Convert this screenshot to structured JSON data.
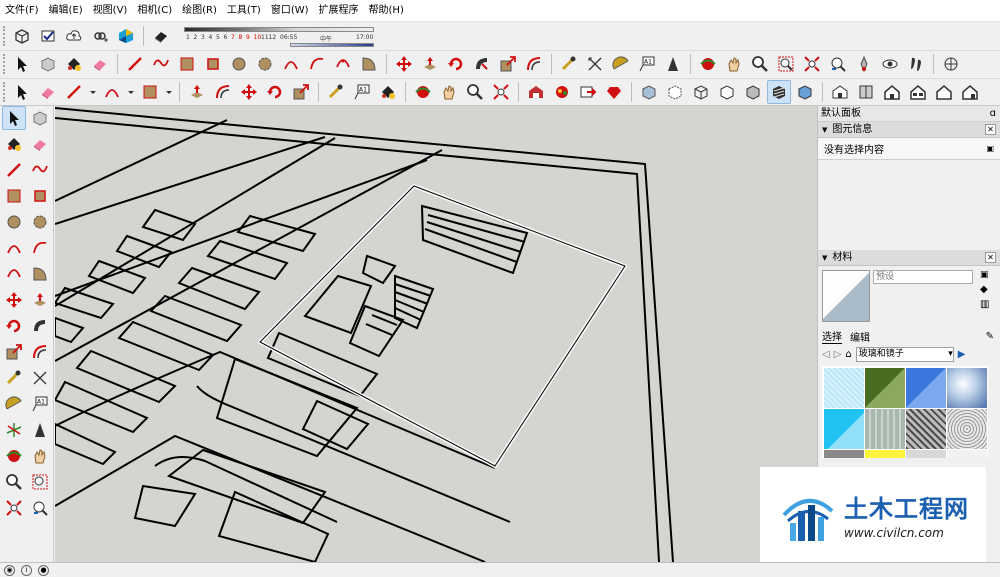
{
  "menu": [
    "文件(F)",
    "编辑(E)",
    "视图(V)",
    "相机(C)",
    "绘图(R)",
    "工具(T)",
    "窗口(W)",
    "扩展程序",
    "帮助(H)"
  ],
  "shadow": {
    "months": [
      "1",
      "2",
      "3",
      "4",
      "5",
      "6",
      "7",
      "8",
      "9",
      "10",
      "11",
      "12"
    ],
    "highlight_months": [
      "7",
      "8",
      "9",
      "10"
    ],
    "times": [
      "06:55",
      "中午",
      "17:00"
    ]
  },
  "panel": {
    "title": "默认面板",
    "entity_section": "图元信息",
    "entity_status": "没有选择内容",
    "materials_section": "材料",
    "material_name_placeholder": "预设",
    "tab_select": "选择",
    "tab_edit": "编辑",
    "library": "玻璃和镜子"
  },
  "colors": {
    "viewport_bg": "#d4d4d0",
    "selection": "#ffffff",
    "accent": "#1a5fb0"
  },
  "materials": [
    "#d5f1fb",
    "#4a6b22",
    "#7ea8f0",
    "#b8cde6",
    "#21c4f0",
    "#a8b8b0",
    "#7c7c7c",
    "#d0d0d0",
    "#8a8a8a",
    "#fff23a",
    "#d8d8d8",
    "#f2f2f2"
  ],
  "watermark": {
    "cn": "土木工程网",
    "url": "www.civilcn.com"
  }
}
